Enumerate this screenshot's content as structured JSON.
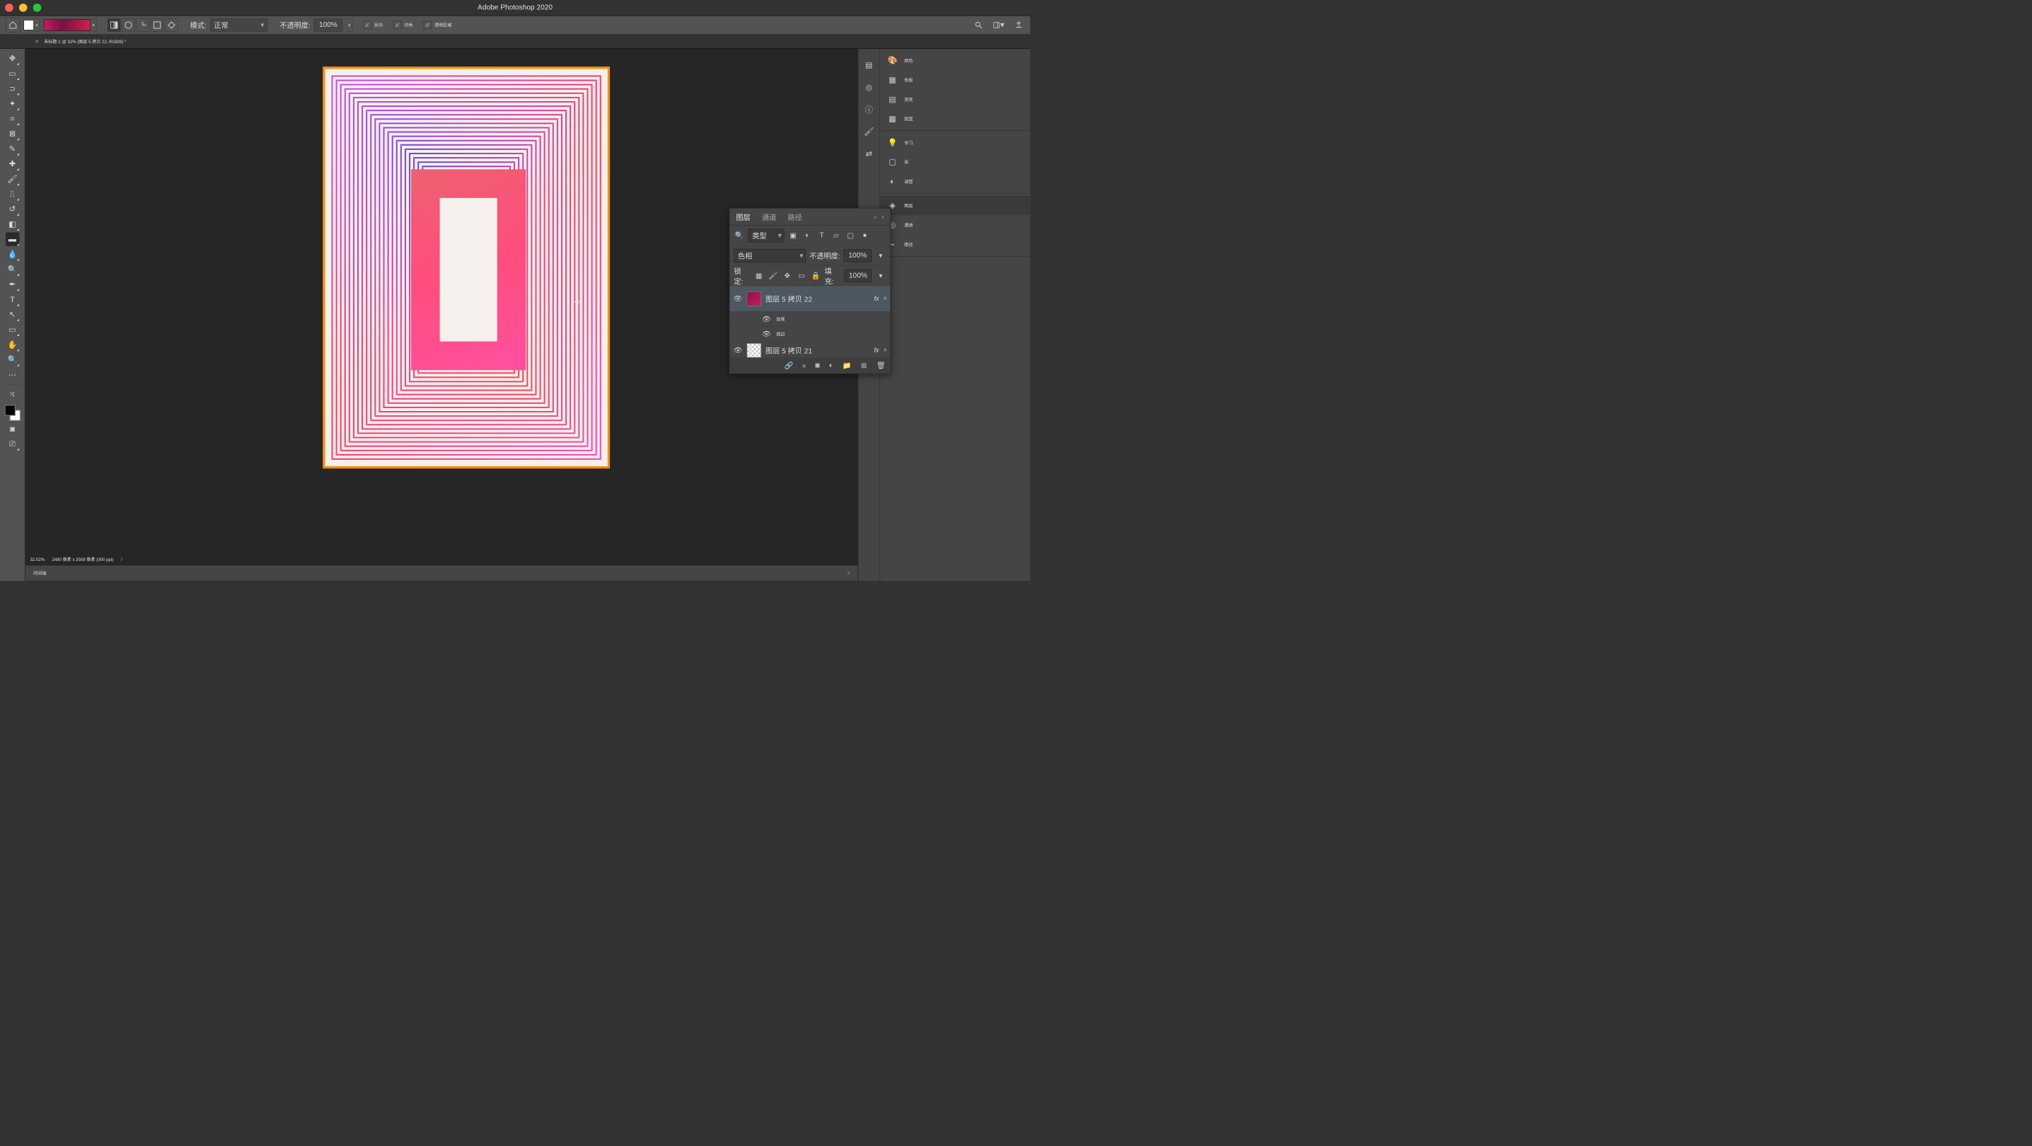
{
  "titlebar": {
    "app_title": "Adobe Photoshop 2020"
  },
  "optbar": {
    "mode_label": "模式:",
    "mode_value": "正常",
    "opacity_label": "不透明度:",
    "opacity_value": "100%",
    "reverse": "反向",
    "dither": "仿色",
    "transparency": "透明区域"
  },
  "doctab": {
    "close": "×",
    "title": "未标题-1 @ 32% (图层 5 拷贝 22, RGB/8) *"
  },
  "status": {
    "zoom": "32.02%",
    "dims": "2480 像素 x 3508 像素 (300 ppi)",
    "arrow": "〉"
  },
  "timeline": {
    "label": "时间轴"
  },
  "rightpanels": {
    "color": "颜色",
    "swatches": "色板",
    "gradients": "渐变",
    "patterns": "图案",
    "learn": "学习",
    "libraries": "库",
    "adjustments": "调整",
    "layers": "图层",
    "channels": "通道",
    "paths": "路径"
  },
  "layerspanel": {
    "tabs": {
      "layers": "图层",
      "channels": "通道",
      "paths": "路径"
    },
    "kind_label": "类型",
    "blend_value": "色相",
    "opacity_label": "不透明度:",
    "opacity_value": "100%",
    "lock_label": "锁定:",
    "fill_label": "填充:",
    "fill_value": "100%",
    "layer1": {
      "name": "图层 5 拷贝 22",
      "fx": "fx"
    },
    "effects_label": "效果",
    "stroke_label": "描边",
    "layer2": {
      "name": "图层 5 拷贝 21",
      "fx": "fx"
    }
  },
  "colors": {
    "canvas_bg": "#262626",
    "panel_bg": "#454545",
    "border_orange": "#ff8a00"
  }
}
